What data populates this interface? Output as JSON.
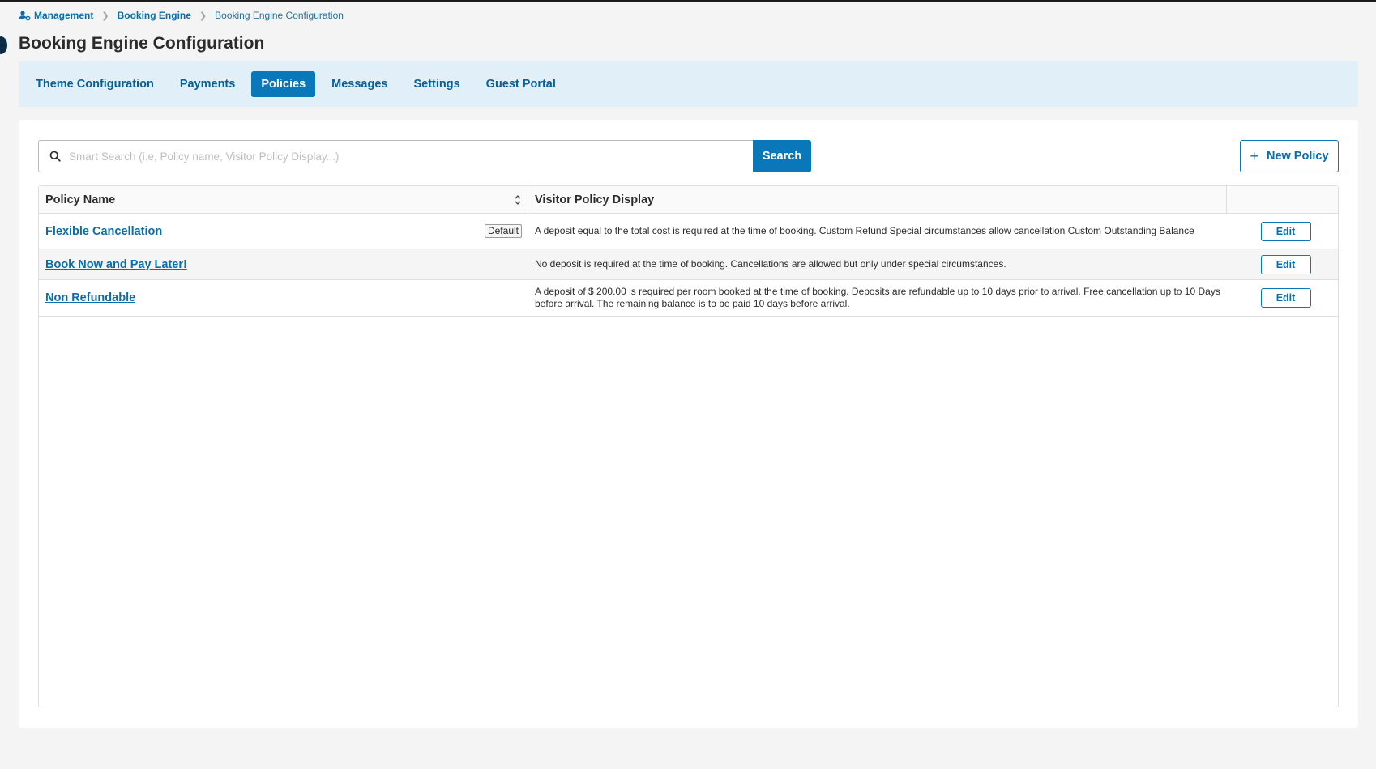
{
  "breadcrumb": {
    "items": [
      "Management",
      "Booking Engine",
      "Booking Engine Configuration"
    ]
  },
  "page": {
    "title": "Booking Engine Configuration"
  },
  "tabs": [
    {
      "label": "Theme Configuration",
      "active": false
    },
    {
      "label": "Payments",
      "active": false
    },
    {
      "label": "Policies",
      "active": true
    },
    {
      "label": "Messages",
      "active": false
    },
    {
      "label": "Settings",
      "active": false
    },
    {
      "label": "Guest Portal",
      "active": false
    }
  ],
  "search": {
    "placeholder": "Smart Search (i.e, Policy name, Visitor Policy Display...)",
    "value": "",
    "button_label": "Search"
  },
  "new_policy_label": "New Policy",
  "table": {
    "headers": [
      "Policy Name",
      "Visitor Policy Display",
      ""
    ],
    "rows": [
      {
        "name": "Flexible Cancellation",
        "badge": "Default",
        "display": "A deposit equal to the total cost is required at the time of booking. Custom Refund Special circumstances allow cancellation Custom Outstanding Balance",
        "action": "Edit"
      },
      {
        "name": "Book Now and Pay Later!",
        "badge": "",
        "display": "No deposit is required at the time of booking.  Cancellations are allowed but only under special circumstances.",
        "action": "Edit"
      },
      {
        "name": "Non Refundable",
        "badge": "",
        "display": "A deposit of $ 200.00 is required per room booked at the time of booking. Deposits are refundable up to 10 days prior to arrival. Free cancellation up to 10 Days before arrival. The remaining balance is to be paid 10 days before arrival.",
        "action": "Edit"
      }
    ]
  },
  "colors": {
    "accent": "#0a77b8",
    "link": "#0a6ea8",
    "tabs_background": "#e1eff8"
  }
}
